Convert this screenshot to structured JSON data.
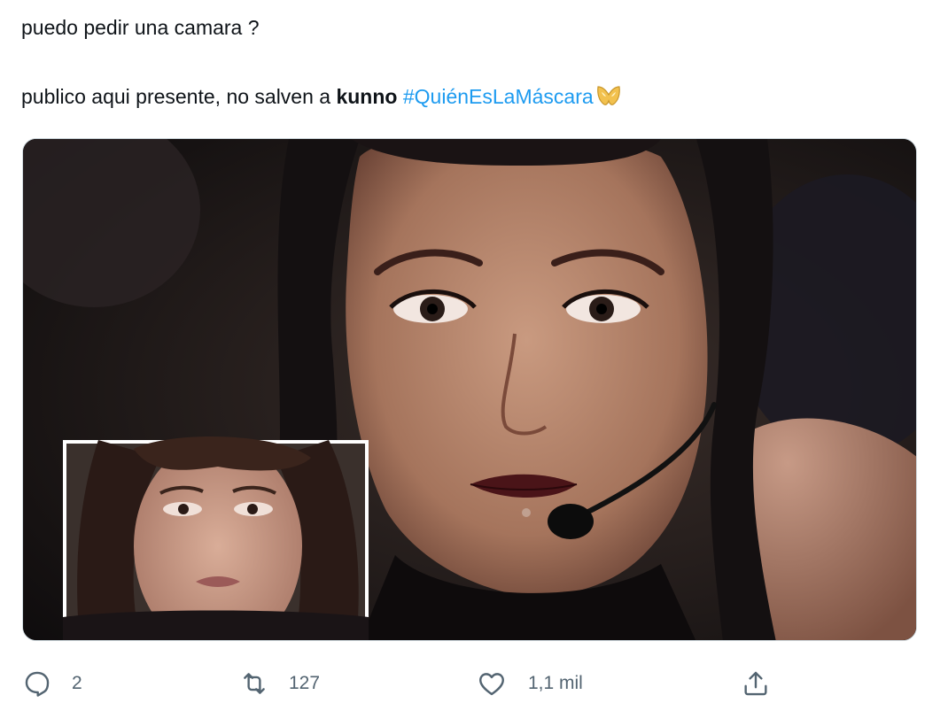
{
  "tweet": {
    "line1": "puedo pedir una camara ?",
    "line2_prefix": "publico aqui presente, no salven a ",
    "line2_bold": "kunno",
    "hashtag": "#QuiénEsLaMáscara",
    "emoji_icon": "golden-mask-emoji",
    "hashtag_color": "#1d9bf0"
  },
  "media": {
    "description_icon": "photo"
  },
  "actions": {
    "reply_count": "2",
    "retweet_count": "127",
    "like_count": "1,1 mil",
    "icon_color": "#536471"
  }
}
